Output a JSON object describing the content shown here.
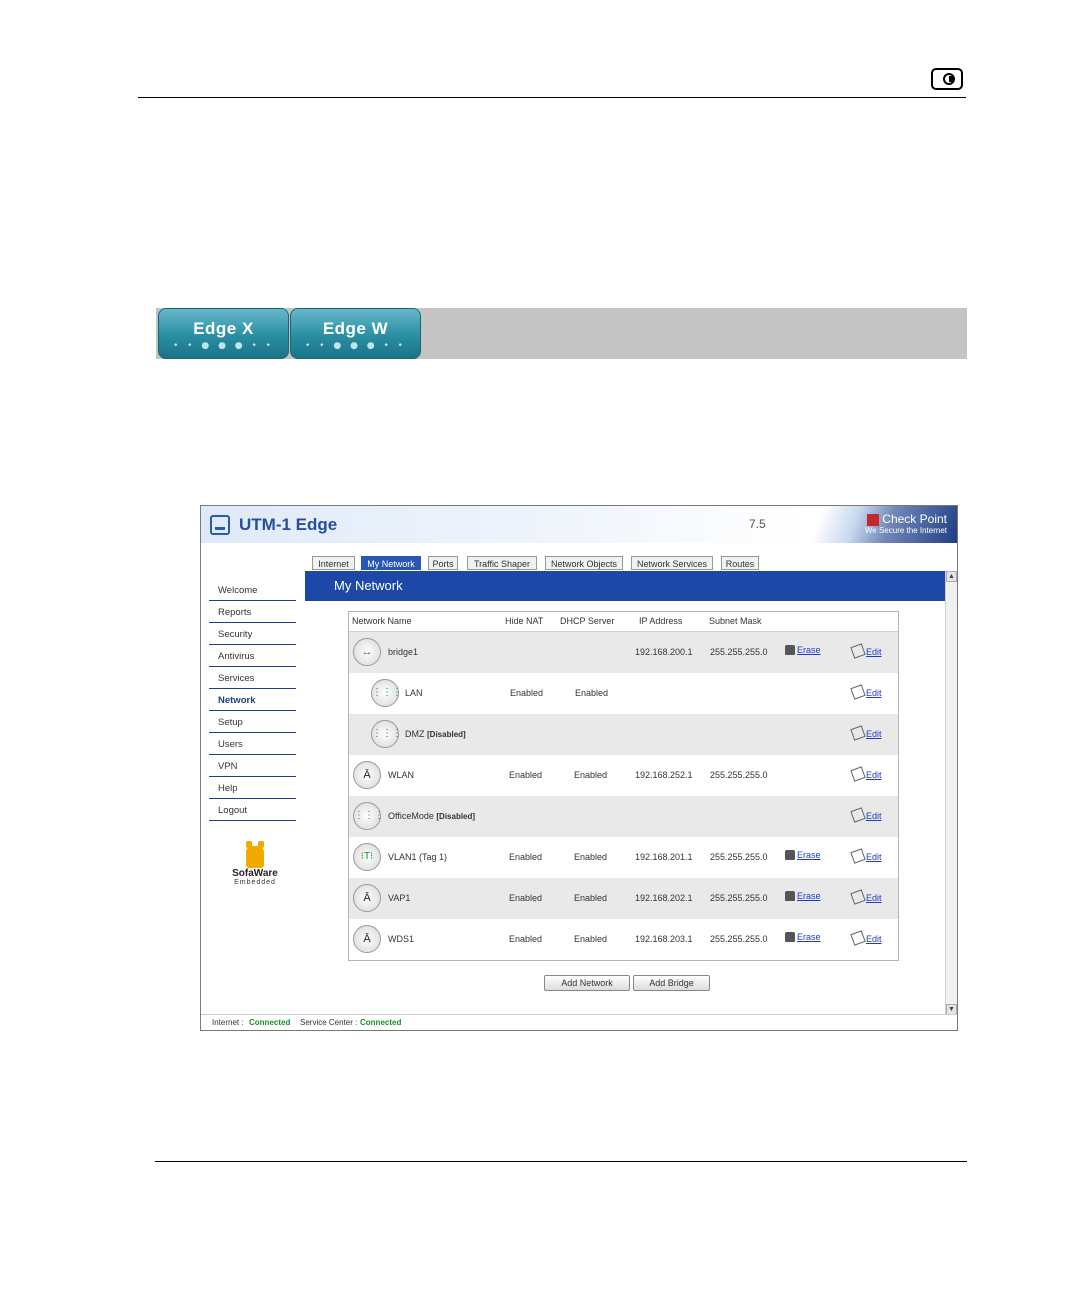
{
  "badges": [
    {
      "label": "Edge X"
    },
    {
      "label": "Edge W"
    }
  ],
  "app": {
    "title": "UTM-1 Edge",
    "version": "7.5",
    "brand_name": "Check Point",
    "brand_tagline": "We Secure the Internet"
  },
  "sidebar": {
    "items": [
      {
        "label": "Welcome"
      },
      {
        "label": "Reports"
      },
      {
        "label": "Security"
      },
      {
        "label": "Antivirus"
      },
      {
        "label": "Services"
      },
      {
        "label": "Network"
      },
      {
        "label": "Setup"
      },
      {
        "label": "Users"
      },
      {
        "label": "VPN"
      },
      {
        "label": "Help"
      },
      {
        "label": "Logout"
      }
    ],
    "active": "Network",
    "logo_name": "SofaWare",
    "logo_sub": "Embedded"
  },
  "tabs": [
    {
      "label": "Internet"
    },
    {
      "label": "My Network"
    },
    {
      "label": "Ports"
    },
    {
      "label": "Traffic Shaper"
    },
    {
      "label": "Network Objects"
    },
    {
      "label": "Network Services"
    },
    {
      "label": "Routes"
    }
  ],
  "content": {
    "heading": "My Network"
  },
  "table": {
    "headers": {
      "name": "Network Name",
      "hide_nat": "Hide NAT",
      "dhcp": "DHCP Server",
      "ip": "IP Address",
      "mask": "Subnet Mask"
    },
    "rows": [
      {
        "name": "bridge1",
        "tag": "",
        "hide_nat": "",
        "dhcp": "",
        "ip": "192.168.200.1",
        "mask": "255.255.255.0",
        "erase": "Erase",
        "edit": "Edit",
        "icon": "bridge-icon"
      },
      {
        "name": "LAN",
        "tag": "",
        "hide_nat": "Enabled",
        "dhcp": "Enabled",
        "ip": "",
        "mask": "",
        "erase": "",
        "edit": "Edit",
        "icon": "hub-icon"
      },
      {
        "name": "DMZ",
        "tag": "[Disabled]",
        "hide_nat": "",
        "dhcp": "",
        "ip": "",
        "mask": "",
        "erase": "",
        "edit": "Edit",
        "icon": "hub-icon"
      },
      {
        "name": "WLAN",
        "tag": "",
        "hide_nat": "Enabled",
        "dhcp": "Enabled",
        "ip": "192.168.252.1",
        "mask": "255.255.255.0",
        "erase": "",
        "edit": "Edit",
        "icon": "antenna-icon"
      },
      {
        "name": "OfficeMode",
        "tag": "[Disabled]",
        "hide_nat": "",
        "dhcp": "",
        "ip": "",
        "mask": "",
        "erase": "",
        "edit": "Edit",
        "icon": "hub-icon"
      },
      {
        "name": "VLAN1 (Tag 1)",
        "tag": "",
        "hide_nat": "Enabled",
        "dhcp": "Enabled",
        "ip": "192.168.201.1",
        "mask": "255.255.255.0",
        "erase": "Erase",
        "edit": "Edit",
        "icon": "vlan-icon"
      },
      {
        "name": "VAP1",
        "tag": "",
        "hide_nat": "Enabled",
        "dhcp": "Enabled",
        "ip": "192.168.202.1",
        "mask": "255.255.255.0",
        "erase": "Erase",
        "edit": "Edit",
        "icon": "antenna-icon"
      },
      {
        "name": "WDS1",
        "tag": "",
        "hide_nat": "Enabled",
        "dhcp": "Enabled",
        "ip": "192.168.203.1",
        "mask": "255.255.255.0",
        "erase": "Erase",
        "edit": "Edit",
        "icon": "antenna-icon"
      }
    ]
  },
  "buttons": {
    "add_network": "Add Network",
    "add_bridge": "Add Bridge"
  },
  "status": {
    "internet_label": "Internet :",
    "internet_value": "Connected",
    "service_label": "Service Center :",
    "service_value": "Connected"
  }
}
